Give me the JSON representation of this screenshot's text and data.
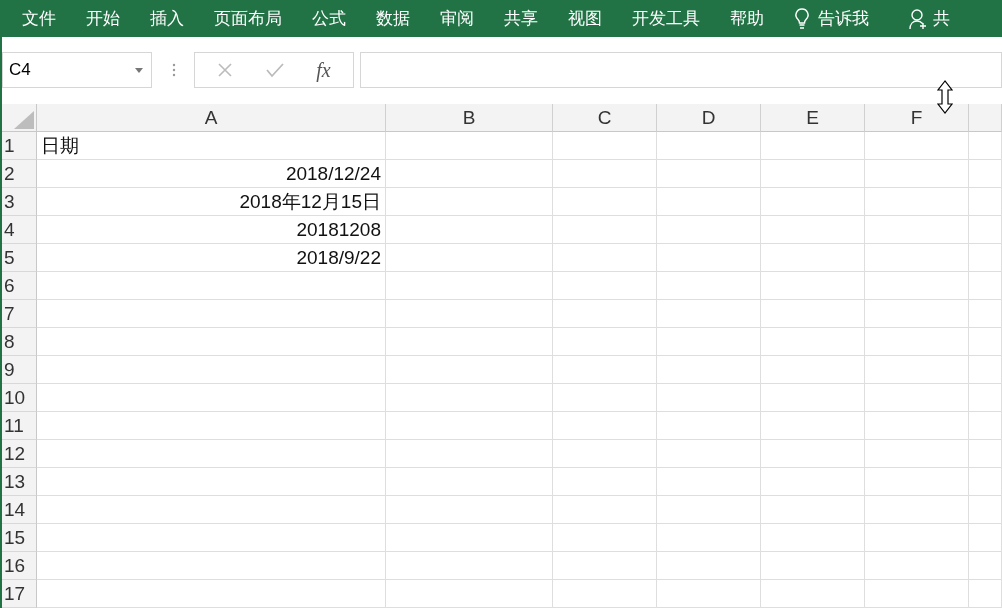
{
  "menu": [
    {
      "label": "文件"
    },
    {
      "label": "开始"
    },
    {
      "label": "插入"
    },
    {
      "label": "页面布局"
    },
    {
      "label": "公式"
    },
    {
      "label": "数据"
    },
    {
      "label": "审阅"
    },
    {
      "label": "共享"
    },
    {
      "label": "视图"
    },
    {
      "label": "开发工具"
    },
    {
      "label": "帮助"
    }
  ],
  "tell_me": "告诉我",
  "share": "共",
  "name_box": "C4",
  "fx": "fx",
  "columns": [
    "A",
    "B",
    "C",
    "D",
    "E",
    "F"
  ],
  "rows": [
    {
      "number": "1",
      "value": "日期",
      "kind": "text"
    },
    {
      "number": "2",
      "value": "2018/12/24",
      "kind": "number"
    },
    {
      "number": "3",
      "value": "2018年12月15日",
      "kind": "number"
    },
    {
      "number": "4",
      "value": "20181208",
      "kind": "number"
    },
    {
      "number": "5",
      "value": "2018/9/22",
      "kind": "number"
    },
    {
      "number": "6"
    },
    {
      "number": "7"
    },
    {
      "number": "8"
    },
    {
      "number": "9"
    },
    {
      "number": "10"
    },
    {
      "number": "11"
    },
    {
      "number": "12"
    },
    {
      "number": "13"
    },
    {
      "number": "14"
    },
    {
      "number": "15"
    },
    {
      "number": "16"
    },
    {
      "number": "17"
    }
  ]
}
